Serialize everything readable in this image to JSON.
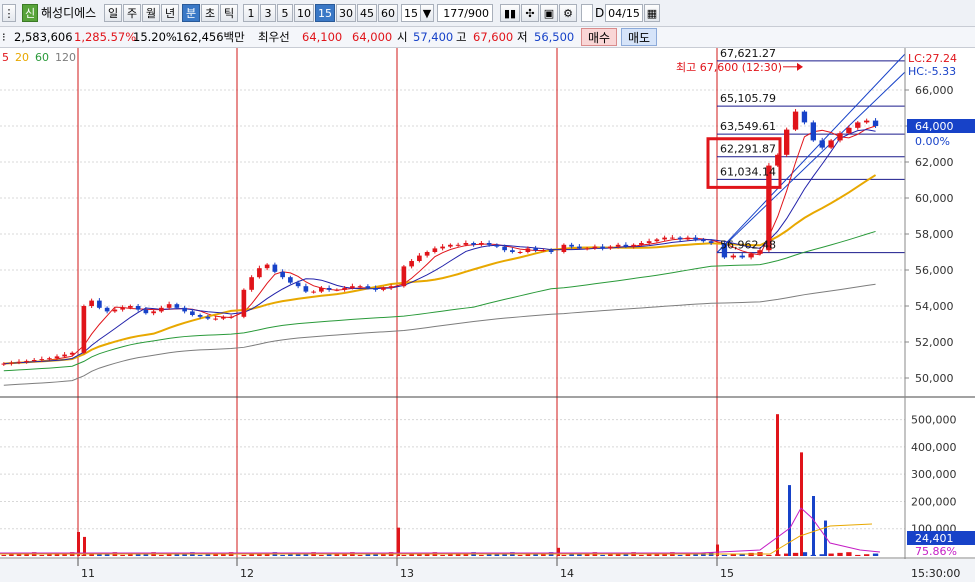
{
  "toolbar": {
    "stock_badge": "신",
    "stock_name": "해성디에스",
    "periods": [
      "일",
      "주",
      "월",
      "년",
      "분",
      "초",
      "틱"
    ],
    "active_period": "분",
    "minute_options": [
      "1",
      "3",
      "5",
      "10",
      "15",
      "30",
      "45",
      "60"
    ],
    "active_minute": "15",
    "interval_select": "15",
    "count_value": "177",
    "count_total": "/900",
    "date_value": "04/15",
    "d_label": "D",
    "icons": [
      "chart-type-icon",
      "crosshair-icon",
      "save-icon",
      "settings-icon",
      "calendar-icon"
    ]
  },
  "infobar": {
    "volume": "2,583,606",
    "volume_rate": "1,285.57%",
    "turnover": "15.20%",
    "amount": "162,456백만",
    "best_ask_label": "최우선",
    "best_ask": "64,100",
    "best_bid": "64,000",
    "open_label": "시",
    "open": "57,400",
    "high_label": "고",
    "high": "67,600",
    "low_label": "저",
    "low": "56,500",
    "buy_button": "매수",
    "sell_button": "매도"
  },
  "legend": {
    "ma_labels": [
      {
        "text": "5",
        "color": "#e0141a"
      },
      {
        "text": "20",
        "color": "#e8a800"
      },
      {
        "text": "60",
        "color": "#2a9a3a"
      },
      {
        "text": "120",
        "color": "#7d7d7d"
      }
    ]
  },
  "annotations": {
    "max_label": "최고 67,600 (12:30)",
    "lc_label": "LC:27.24",
    "hc_label": "HC:-5.33",
    "current_price": "64,000",
    "current_change": "0.00%",
    "volume_current": "24,401",
    "volume_pct": "75.86%",
    "fib_levels": [
      "67,621.27",
      "65,105.79",
      "63,549.61",
      "62,291.87",
      "61,034.14",
      "56,962.48"
    ]
  },
  "chart_data": {
    "type": "candlestick",
    "price_axis": {
      "min": 49000,
      "max": 68000,
      "ticks": [
        "50,000",
        "52,000",
        "54,000",
        "56,000",
        "58,000",
        "60,000",
        "62,000",
        "64,000",
        "66,000"
      ]
    },
    "volume_axis": {
      "min": 0,
      "max": 550000,
      "ticks": [
        "100,000",
        "200,000",
        "300,000",
        "400,000",
        "500,000"
      ]
    },
    "date_labels": [
      "11",
      "12",
      "13",
      "14",
      "15"
    ],
    "time_label": "15:30:00",
    "fib_values": [
      67621.27,
      65105.79,
      63549.61,
      62291.87,
      61034.14,
      56962.48
    ],
    "current_price": 64000,
    "session_closes": [
      [
        50800,
        50850,
        50900,
        50950,
        51000,
        51050,
        51100,
        51200,
        51300,
        51400
      ],
      [
        54000,
        54300,
        53900,
        53700,
        53800,
        53900,
        54000,
        53800,
        53600,
        53700,
        53900,
        54100,
        53900,
        53700,
        53500,
        53400,
        53300,
        53300,
        53400,
        53400
      ],
      [
        54900,
        55600,
        56100,
        56300,
        55900,
        55600,
        55300,
        55100,
        54800,
        54800,
        55000,
        54900,
        54900,
        55000,
        55100,
        55100,
        55000,
        54900,
        55000,
        55100
      ],
      [
        56200,
        56500,
        56800,
        57000,
        57200,
        57300,
        57400,
        57400,
        57500,
        57400,
        57500,
        57400,
        57300,
        57100,
        57000,
        57000,
        57200,
        57100,
        57100,
        57000
      ],
      [
        57400,
        57300,
        57200,
        57200,
        57300,
        57200,
        57300,
        57400,
        57300,
        57400,
        57500,
        57600,
        57700,
        57800,
        57800,
        57700,
        57800,
        57700,
        57600,
        57500
      ],
      [
        56700,
        56800,
        56700,
        56900,
        57100,
        61800,
        62400,
        63800,
        64800,
        64200,
        63200,
        62800,
        63200,
        63600,
        63900,
        64200,
        64300,
        64000
      ]
    ],
    "volume_spike_values": [
      88000,
      70000,
      104000,
      30000,
      42000,
      520000,
      260000,
      380000,
      220000,
      130000
    ]
  }
}
